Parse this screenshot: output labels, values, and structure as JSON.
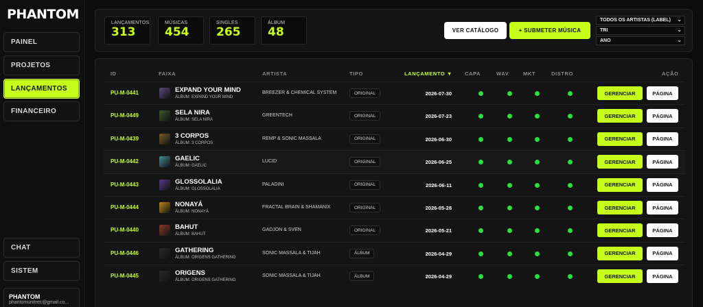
{
  "brand": "PHANTOM",
  "sidebar": {
    "items": [
      {
        "label": "Painel"
      },
      {
        "label": "Projetos"
      },
      {
        "label": "Lançamentos"
      },
      {
        "label": "Financeiro"
      }
    ],
    "bottom": [
      {
        "label": "Chat"
      },
      {
        "label": "Sistem"
      }
    ],
    "user": {
      "name": "PHANTOM",
      "email": "phantomunitrec@gmail.co..."
    }
  },
  "stats": [
    {
      "label": "Lançamentos",
      "value": "313"
    },
    {
      "label": "Músicas",
      "value": "454"
    },
    {
      "label": "Singles",
      "value": "265"
    },
    {
      "label": "Álbum",
      "value": "48"
    }
  ],
  "actions": {
    "catalog": "Ver Catálogo",
    "submit": "+ Submeter Música"
  },
  "filters": [
    {
      "value": "Todos os artistas (label)"
    },
    {
      "value": "Tri"
    },
    {
      "value": "Ano"
    }
  ],
  "table": {
    "headers": {
      "id": "ID",
      "faixa": "Faixa",
      "artista": "Artista",
      "tipo": "Tipo",
      "lancamento": "Lançamento ▼",
      "capa": "Capa",
      "wav": "WAV",
      "mkt": "MKT",
      "distro": "Distro",
      "acao": "Ação"
    },
    "button_manage": "Gerenciar",
    "button_page": "Página",
    "rows": [
      {
        "id": "PU-M-0441",
        "title": "EXPAND YOUR MIND",
        "album": "ÁLBUM: EXPAND YOUR MIND",
        "artist": "BREEZER & CHEMICAL SYSTEM",
        "tipo": "ORIGINAL",
        "date": "2026-07-30",
        "thumb_color": "#5a4a7a"
      },
      {
        "id": "PU-M-0449",
        "title": "SELA NIRA",
        "album": "ÁLBUM: SELA NIRA",
        "artist": "GREENTECH",
        "tipo": "ORIGINAL",
        "date": "2026-07-23",
        "thumb_color": "#3a5a2a"
      },
      {
        "id": "PU-M-0439",
        "title": "3 CORPOS",
        "album": "ÁLBUM: 3 CORPOS",
        "artist": "REMP & SONIC MASSALA",
        "tipo": "ORIGINAL",
        "date": "2026-06-30",
        "thumb_color": "#7a5a2a"
      },
      {
        "id": "PU-M-0442",
        "title": "GAELIC",
        "album": "ÁLBUM: GAELIC",
        "artist": "LUCID",
        "tipo": "ORIGINAL",
        "date": "2026-06-25",
        "thumb_color": "#4a8a9a"
      },
      {
        "id": "PU-M-0443",
        "title": "GLOSSOLALIA",
        "album": "ÁLBUM: GLOSSOLALIA",
        "artist": "PALADINI",
        "tipo": "ORIGINAL",
        "date": "2026-06-11",
        "thumb_color": "#5a3a8a"
      },
      {
        "id": "PU-M-0444",
        "title": "NONAYÁ",
        "album": "ÁLBUM: NONAYÁ",
        "artist": "FRACTAL BRAIN & SHAMANIX",
        "tipo": "ORIGINAL",
        "date": "2026-05-28",
        "thumb_color": "#b88a1a"
      },
      {
        "id": "PU-M-0440",
        "title": "BAHUT",
        "album": "ÁLBUM: BAHUT",
        "artist": "GADJON & SVEN",
        "tipo": "ORIGINAL",
        "date": "2026-05-21",
        "thumb_color": "#8a3a2a"
      },
      {
        "id": "PU-M-0446",
        "title": "GATHERING",
        "album": "ÁLBUM: ORIGENS GATHERING",
        "artist": "SONIC MASSALA & TIJAH",
        "tipo": "ÁLBUM",
        "date": "2026-04-29",
        "thumb_color": "#2a2a2a"
      },
      {
        "id": "PU-M-0445",
        "title": "ORIGENS",
        "album": "ÁLBUM: ORIGENS GATHERING",
        "artist": "SONIC MASSALA & TIJAH",
        "tipo": "ÁLBUM",
        "date": "2026-04-29",
        "thumb_color": "#2a2a2a"
      }
    ]
  },
  "colors": {
    "accent": "#c6ff1a",
    "status_ok": "#27e23a"
  }
}
